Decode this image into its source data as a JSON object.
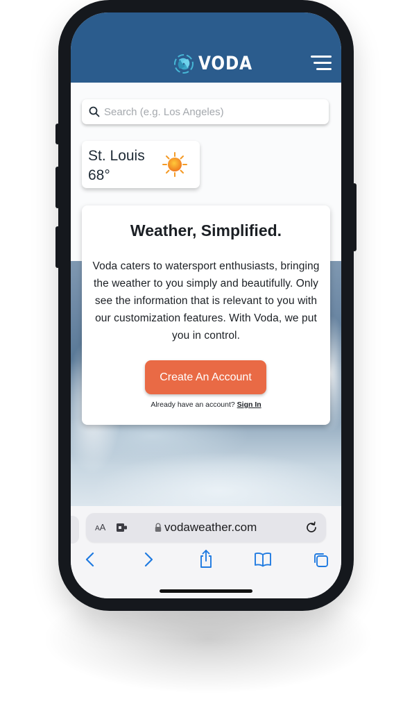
{
  "app": {
    "brand_name": "VODA",
    "accent_color": "#2b5c8d",
    "cta_color": "#e96a45"
  },
  "header": {
    "logo_icon": "voda-swirl-logo",
    "menu_icon": "hamburger-menu-icon"
  },
  "search": {
    "placeholder": "Search (e.g. Los Angeles)",
    "icon": "search-icon"
  },
  "city_card": {
    "city": "St. Louis",
    "temperature": "68°",
    "condition_icon": "sun-icon"
  },
  "hero": {
    "title": "Weather, Simplified.",
    "body": "Voda caters to watersport enthusiasts, bringing the weather to you simply and beautifully. Only see the information that is relevant to you with our customization features. With Voda, we put you in control.",
    "cta_label": "Create An Account",
    "signin_prompt": "Already have an account?",
    "signin_link": "Sign In"
  },
  "browser": {
    "text_size_label_small": "A",
    "text_size_label_large": "A",
    "url": "vodaweather.com",
    "icons": [
      "puzzle-extension-icon",
      "lock-icon",
      "reload-icon",
      "back-icon",
      "forward-icon",
      "share-icon",
      "bookmarks-icon",
      "tabs-icon"
    ]
  }
}
